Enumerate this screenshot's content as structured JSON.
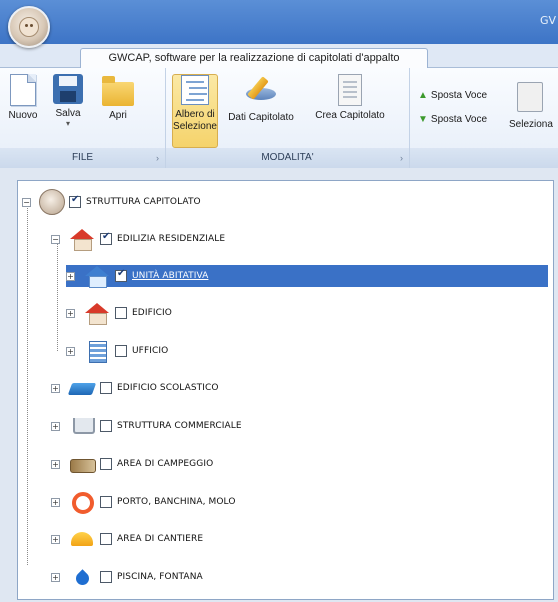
{
  "window": {
    "title_partial": "GV"
  },
  "ribbon_tab": {
    "label": "GWCAP, software per la realizzazione di capitolati d'appalto"
  },
  "groups": {
    "file": {
      "label": "FILE",
      "buttons": [
        {
          "label": "Nuovo",
          "icon": "new-document-icon"
        },
        {
          "label": "Salva",
          "icon": "floppy-disk-icon"
        },
        {
          "label": "Apri",
          "icon": "folder-icon"
        }
      ]
    },
    "modalita": {
      "label": "MODALITA'",
      "buttons": [
        {
          "label_line1": "Albero di",
          "label_line2": "Selezione",
          "icon": "tree-panel-icon",
          "active": true
        },
        {
          "label": "Dati Capitolato",
          "icon": "edit-pencil-icon"
        },
        {
          "label": "Crea Capitolato",
          "icon": "document-page-icon"
        }
      ]
    },
    "sposta": {
      "up_label": "Sposta Voce",
      "down_label": "Sposta Voce",
      "select_label": "Seleziona"
    }
  },
  "tree": {
    "nodes": [
      {
        "label": "STRUTTURA CAPITOLATO",
        "checked": true,
        "expander": "−",
        "icon": "capitolato-orb-icon"
      },
      {
        "label": "EDILIZIA RESIDENZIALE",
        "checked": true,
        "expander": "−",
        "icon": "red-roof-house-icon"
      },
      {
        "label": "UNITÀ ABITATIVA",
        "checked": true,
        "expander": "+",
        "icon": "blue-house-icon",
        "selected": true
      },
      {
        "label": "EDIFICIO",
        "checked": false,
        "expander": "+",
        "icon": "red-house-icon"
      },
      {
        "label": "UFFICIO",
        "checked": false,
        "expander": "+",
        "icon": "office-building-icon"
      },
      {
        "label": "EDIFICIO SCOLASTICO",
        "checked": false,
        "expander": "+",
        "icon": "school-book-icon"
      },
      {
        "label": "STRUTTURA COMMERCIALE",
        "checked": false,
        "expander": "+",
        "icon": "shopping-cart-icon"
      },
      {
        "label": "AREA DI CAMPEGGIO",
        "checked": false,
        "expander": "+",
        "icon": "camper-icon"
      },
      {
        "label": "PORTO, BANCHINA, MOLO",
        "checked": false,
        "expander": "+",
        "icon": "lifebuoy-icon"
      },
      {
        "label": "AREA DI CANTIERE",
        "checked": false,
        "expander": "+",
        "icon": "hard-hat-icon"
      },
      {
        "label": "PISCINA, FONTANA",
        "checked": false,
        "expander": "+",
        "icon": "water-drop-icon"
      }
    ]
  },
  "colors": {
    "title_bar": "#4a80cc",
    "selection": "#3a71c6",
    "active_button": "#f5d36b"
  }
}
